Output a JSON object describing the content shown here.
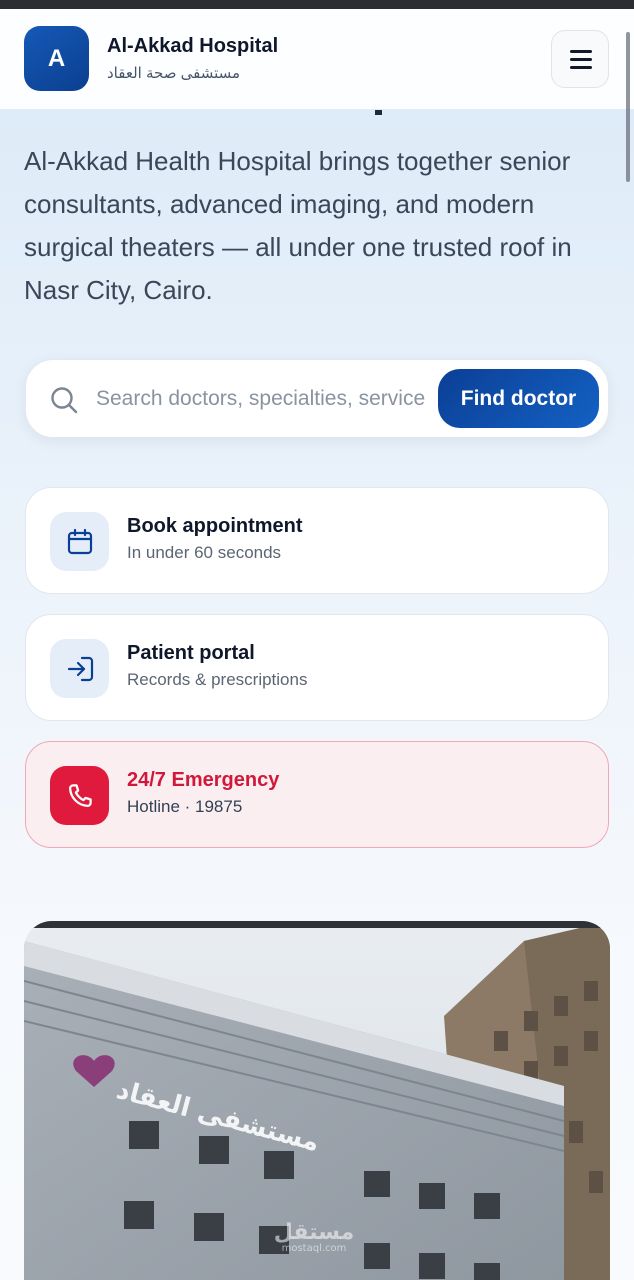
{
  "header": {
    "logo_letter": "A",
    "brand_name": "Al-Akkad Hospital",
    "brand_subtitle": "مستشفى صحة العقاد"
  },
  "hero": {
    "intro": "Al-Akkad Health Hospital brings together senior consultants, advanced imaging, and modern surgical theaters — all under one trusted roof in Nasr City, Cairo."
  },
  "search": {
    "placeholder": "Search doctors, specialties, services",
    "value": "",
    "button_label": "Find doctor"
  },
  "quick_actions": [
    {
      "title": "Book appointment",
      "subtitle": "In under 60 seconds",
      "icon": "calendar-icon"
    },
    {
      "title": "Patient portal",
      "subtitle": "Records & prescriptions",
      "icon": "login-icon"
    },
    {
      "title": "24/7 Emergency",
      "subtitle": "Hotline · 19875",
      "icon": "phone-icon"
    }
  ],
  "building_photo": {
    "sign_text": "مستشفى العقاد",
    "watermark_arabic": "مستقل",
    "watermark_latin": "mostaql.com"
  },
  "colors": {
    "primary": "#0b3f95",
    "emergency": "#e01a3c",
    "emergency_bg": "#fbeef1"
  }
}
